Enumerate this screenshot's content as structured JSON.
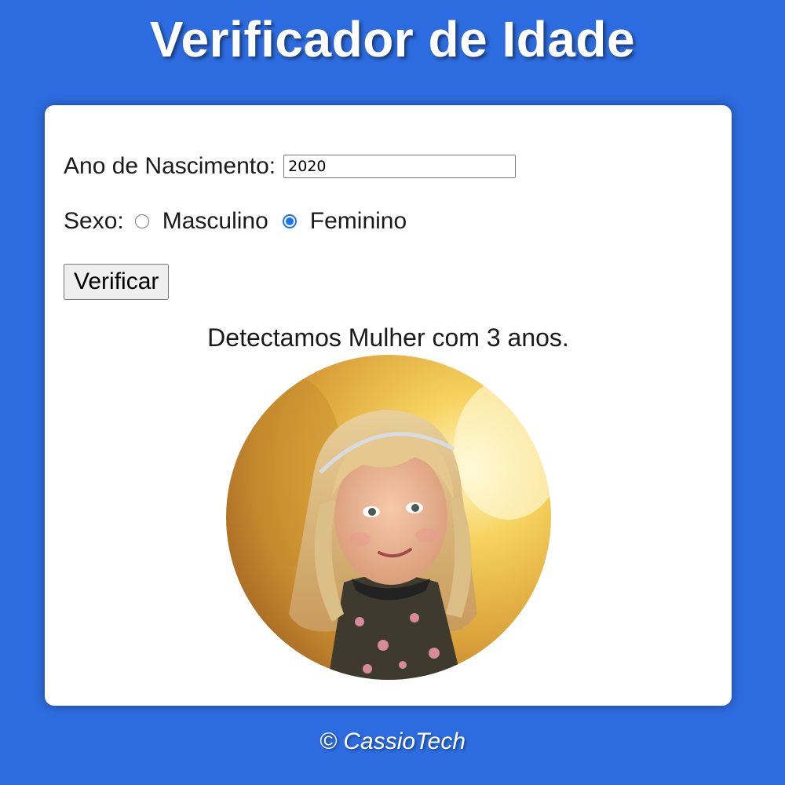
{
  "header": {
    "title": "Verificador de Idade"
  },
  "form": {
    "year_label": "Ano de Nascimento:",
    "year_value": "2020",
    "sex_label": "Sexo:",
    "sex_options": [
      {
        "label": "Masculino",
        "selected": false
      },
      {
        "label": "Feminino",
        "selected": true
      }
    ],
    "verify_label": "Verificar"
  },
  "result": {
    "text": "Detectamos Mulher com 3 anos.",
    "image": "girl-child-photo"
  },
  "footer": {
    "text": "© CassioTech"
  },
  "colors": {
    "background": "#2d6ce0",
    "card": "#ffffff",
    "radio_selected": "#1a73e8"
  }
}
